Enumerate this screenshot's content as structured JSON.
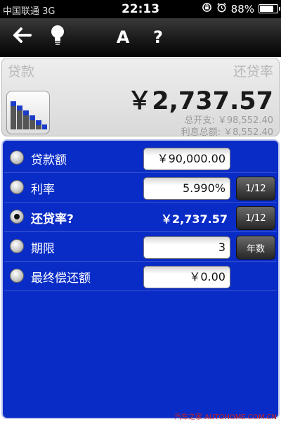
{
  "status_bar": {
    "carrier": "中国联通 3G",
    "time": "22:13",
    "battery_percent": "88%",
    "battery_level": 0.88,
    "icons": [
      "lock-rotation-icon",
      "alarm-icon",
      "battery-icon"
    ]
  },
  "toolbar": {
    "icons": [
      "back-arrow-icon",
      "lightbulb-icon"
    ],
    "font_button_label": "A",
    "help_button_label": "?"
  },
  "display": {
    "left_title": "贷款",
    "right_title": "还贷率",
    "amount": "￥2,737.57",
    "total_cost": "总开支: ￥98,552.40",
    "total_interest": "利息总额: ￥8,552.40"
  },
  "form": {
    "rows": [
      {
        "label": "贷款额",
        "value": "￥90,000.00",
        "selected": false
      },
      {
        "label": "利率",
        "value": "5.990%",
        "button": "1/12",
        "selected": false
      },
      {
        "label": "还贷率?",
        "value": "￥2,737.57",
        "button": "1/12",
        "selected": true
      },
      {
        "label": "期限",
        "value": "3",
        "button": "年数",
        "selected": false
      },
      {
        "label": "最终偿还额",
        "value": "￥0.00",
        "selected": false
      }
    ]
  },
  "watermark": "汽车之家 AUTOHOME.COM.CN",
  "colors": {
    "panel_blue": "#0a2cc6",
    "toolbar_black": "#111111"
  }
}
